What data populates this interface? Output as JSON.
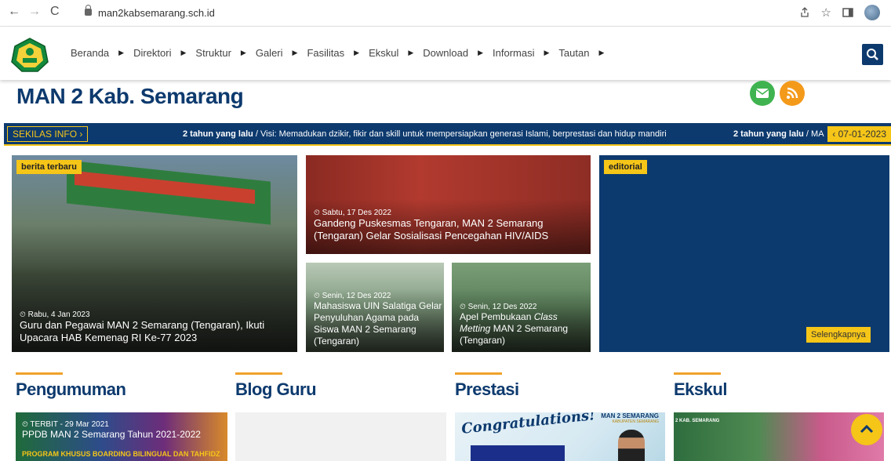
{
  "browser": {
    "url": "man2kabsemarang.sch.id",
    "icons": [
      "back-icon",
      "forward-icon",
      "reload-icon",
      "lock-icon",
      "share-icon",
      "star-icon",
      "sidebar-icon",
      "profile-avatar"
    ]
  },
  "nav": {
    "items": [
      {
        "label": "Beranda"
      },
      {
        "label": "Direktori"
      },
      {
        "label": "Struktur"
      },
      {
        "label": "Galeri"
      },
      {
        "label": "Fasilitas"
      },
      {
        "label": "Ekskul"
      },
      {
        "label": "Download"
      },
      {
        "label": "Informasi"
      },
      {
        "label": "Tautan"
      }
    ]
  },
  "site": {
    "title": "MAN 2 Kab. Semarang"
  },
  "ticker": {
    "label": "SEKILAS INFO",
    "time": "2 tahun yang lalu",
    "text": " / Visi: Memadukan dzikir, fikir dan skill untuk mempersiapkan generasi Islami, berprestasi dan hidup mandiri",
    "time2": "2 tahun yang lalu",
    "text2": " / MA",
    "date": "07-01-2023"
  },
  "news": {
    "main": {
      "tag": "berita terbaru",
      "date": "Rabu, 4 Jan 2023",
      "title": "Guru dan Pegawai MAN 2 Semarang (Tengaran), Ikuti Upacara HAB Kemenag RI Ke-77 2023"
    },
    "top": {
      "date": "Sabtu, 17 Des 2022",
      "title": "Gandeng Puskesmas Tengaran, MAN 2 Semarang (Tengaran) Gelar Sosialisasi Pencegahan HIV/AIDS"
    },
    "bl": {
      "date": "Senin, 12 Des 2022",
      "title": "Mahasiswa UIN Salatiga Gelar Penyuluhan Agama pada Siswa MAN 2 Semarang (Tengaran)"
    },
    "br": {
      "date": "Senin, 12 Des 2022",
      "title_a": "Apel Pembukaan ",
      "title_i": "Class Metting",
      "title_b": " MAN 2 Semarang (Tengaran)"
    },
    "editorial": {
      "tag": "editorial",
      "more": "Selengkapnya"
    }
  },
  "sections": [
    {
      "title": "Pengumuman"
    },
    {
      "title": "Blog Guru"
    },
    {
      "title": "Prestasi"
    },
    {
      "title": "Ekskul"
    }
  ],
  "pengumuman": {
    "meta": "TERBIT - 29 Mar 2021",
    "title": "PPDB MAN 2 Semarang Tahun 2021-2022",
    "banner": "PROGRAM KHUSUS BOARDING BILINGUAL DAN TAHFIDZ"
  },
  "prestasi": {
    "script": "Congratulations!",
    "school": "MAN 2 SEMARANG",
    "sub": "KABUPATEN SEMARANG"
  },
  "ekskul": {
    "school": "2 KAB. SEMARANG"
  },
  "colors": {
    "navy": "#0d3a6e",
    "yellow": "#f5c518",
    "orange": "#f0a22b"
  }
}
